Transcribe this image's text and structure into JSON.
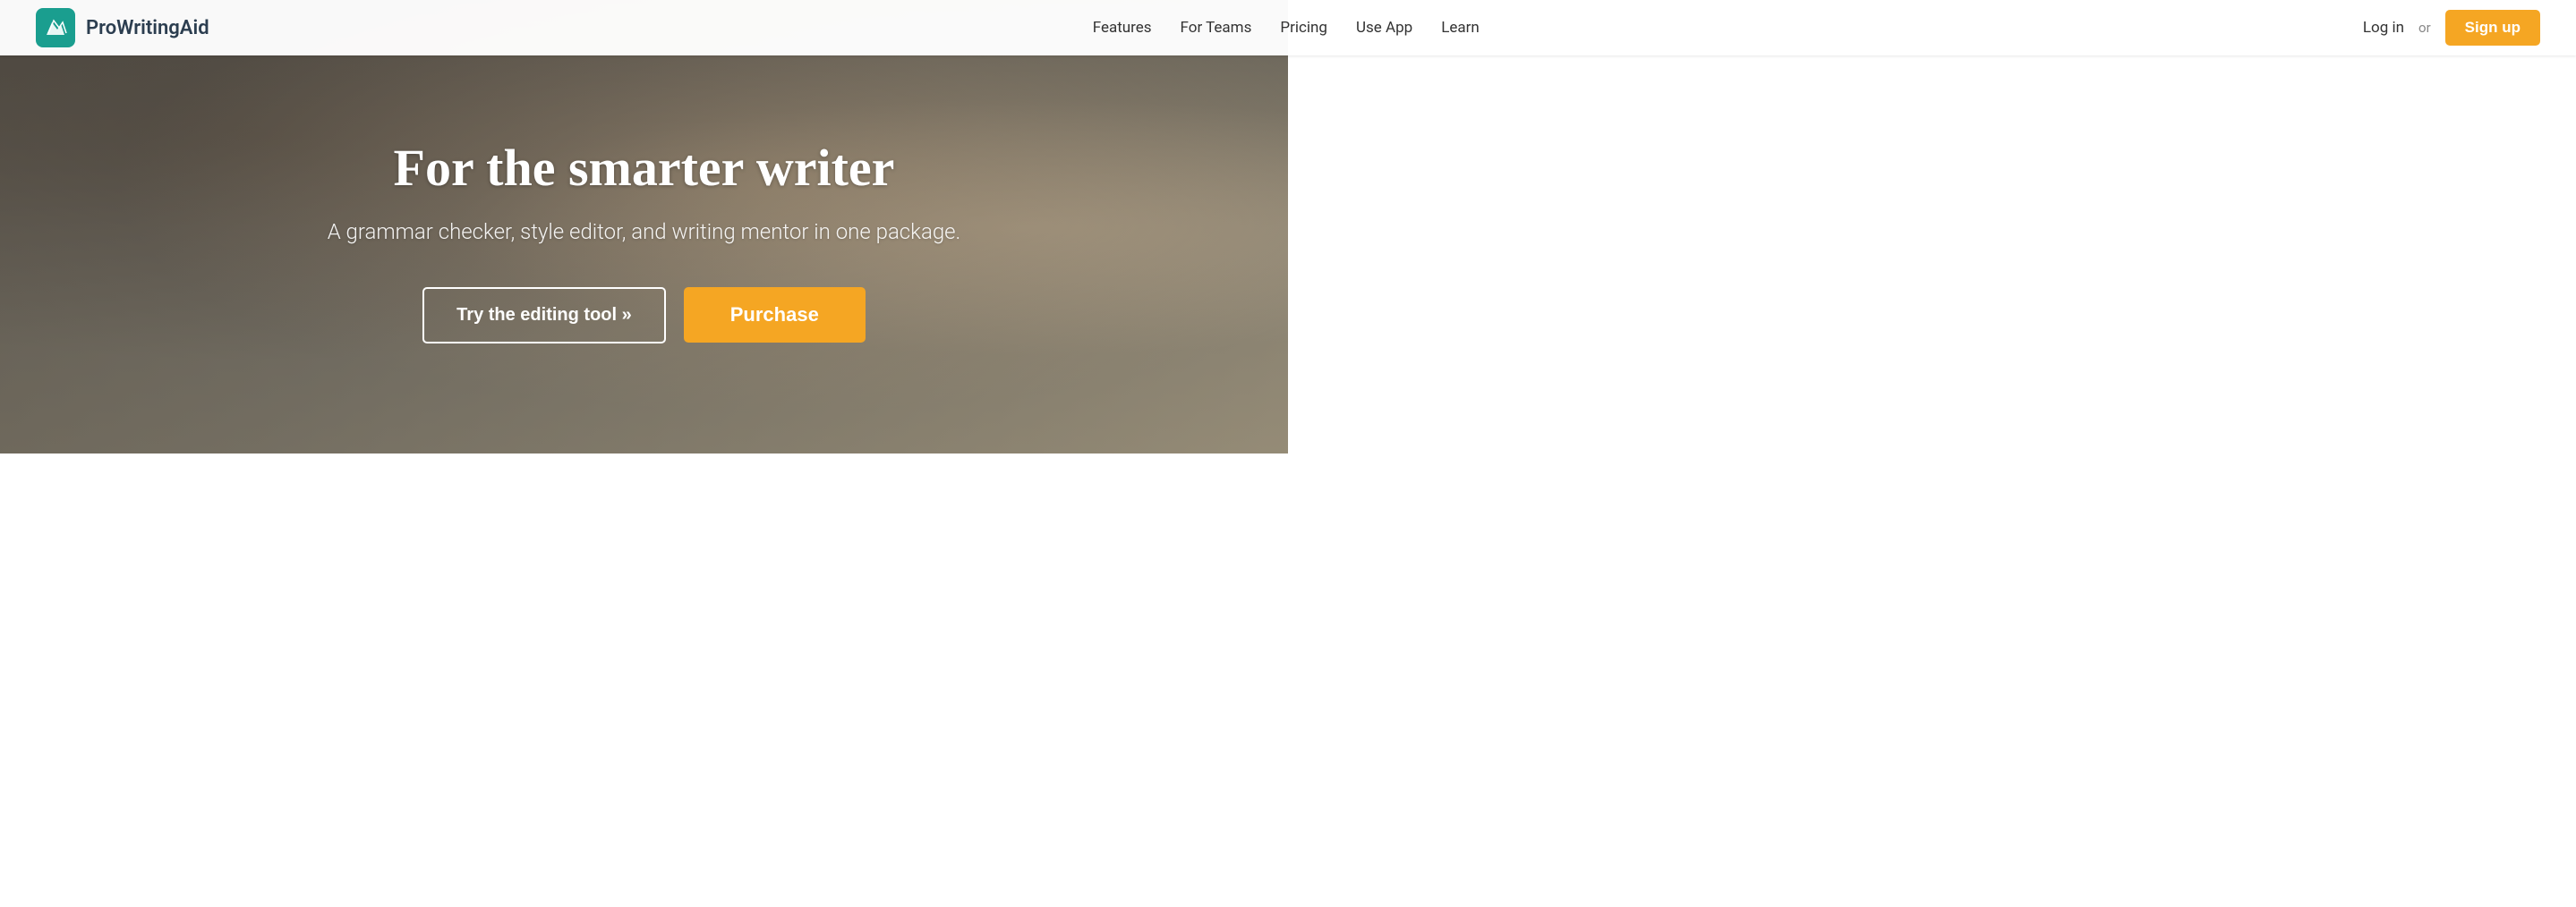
{
  "nav": {
    "logo_text": "ProWritingAid",
    "links": [
      {
        "label": "Features",
        "id": "features"
      },
      {
        "label": "For Teams",
        "id": "for-teams"
      },
      {
        "label": "Pricing",
        "id": "pricing"
      },
      {
        "label": "Use App",
        "id": "use-app"
      },
      {
        "label": "Learn",
        "id": "learn"
      }
    ],
    "login_label": "Log in",
    "or_label": "or",
    "signup_label": "Sign up"
  },
  "hero": {
    "title": "For the smarter writer",
    "subtitle": "A grammar checker, style editor, and writing mentor in one package.",
    "try_button": "Try the editing tool »",
    "purchase_button": "Purchase"
  }
}
